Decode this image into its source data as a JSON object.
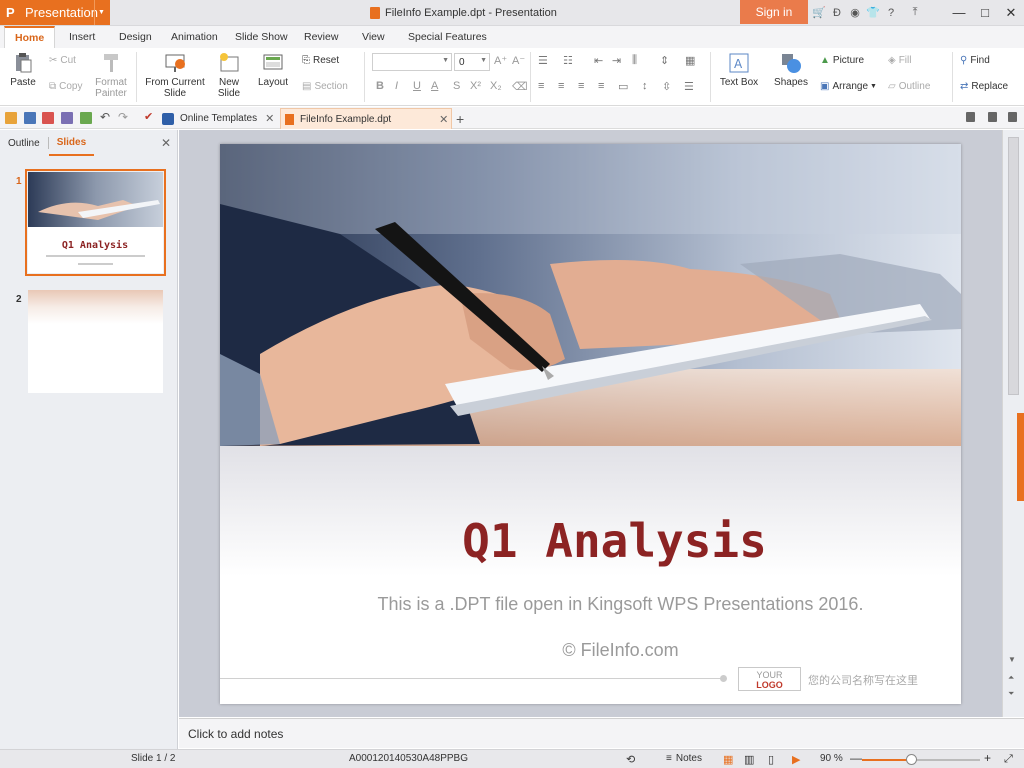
{
  "app": {
    "menu_label": "Presentation",
    "logo_glyph": "P",
    "title": "FileInfo Example.dpt - Presentation",
    "signin": "Sign in"
  },
  "tabs": [
    "Home",
    "Insert",
    "Design",
    "Animation",
    "Slide Show",
    "Review",
    "View",
    "Special Features"
  ],
  "ribbon": {
    "paste": "Paste",
    "cut": "Cut",
    "copy": "Copy",
    "format_painter_1": "Format",
    "format_painter_2": "Painter",
    "from_current_1": "From Current",
    "from_current_2": "Slide",
    "new_slide_1": "New",
    "new_slide_2": "Slide",
    "layout": "Layout",
    "reset": "Reset",
    "section": "Section",
    "font_size": "0",
    "text_box": "Text Box",
    "shapes": "Shapes",
    "picture": "Picture",
    "arrange": "Arrange",
    "fill": "Fill",
    "outline": "Outline",
    "find": "Find",
    "replace": "Replace"
  },
  "doc_tabs": {
    "online_templates": "Online Templates",
    "file": "FileInfo Example.dpt"
  },
  "left_pane": {
    "outline": "Outline",
    "slides": "Slides",
    "thumb1_num": "1",
    "thumb2_num": "2"
  },
  "slide": {
    "title": "Q1 Analysis",
    "subtitle": "This is a .DPT file open in Kingsoft WPS Presentations 2016.",
    "copyright": "© FileInfo.com",
    "logo_your": "YOUR",
    "logo_logo": "LOGO",
    "company_text": "您的公司名称写在这里"
  },
  "notes_placeholder": "Click to add notes",
  "status": {
    "slide": "Slide 1 / 2",
    "id": "A000120140530A48PPBG",
    "notes": "Notes",
    "zoom": "90 %",
    "zoom_fraction": 0.42
  },
  "colors": {
    "accent": "#e8701f",
    "title_red": "#8c2323"
  }
}
